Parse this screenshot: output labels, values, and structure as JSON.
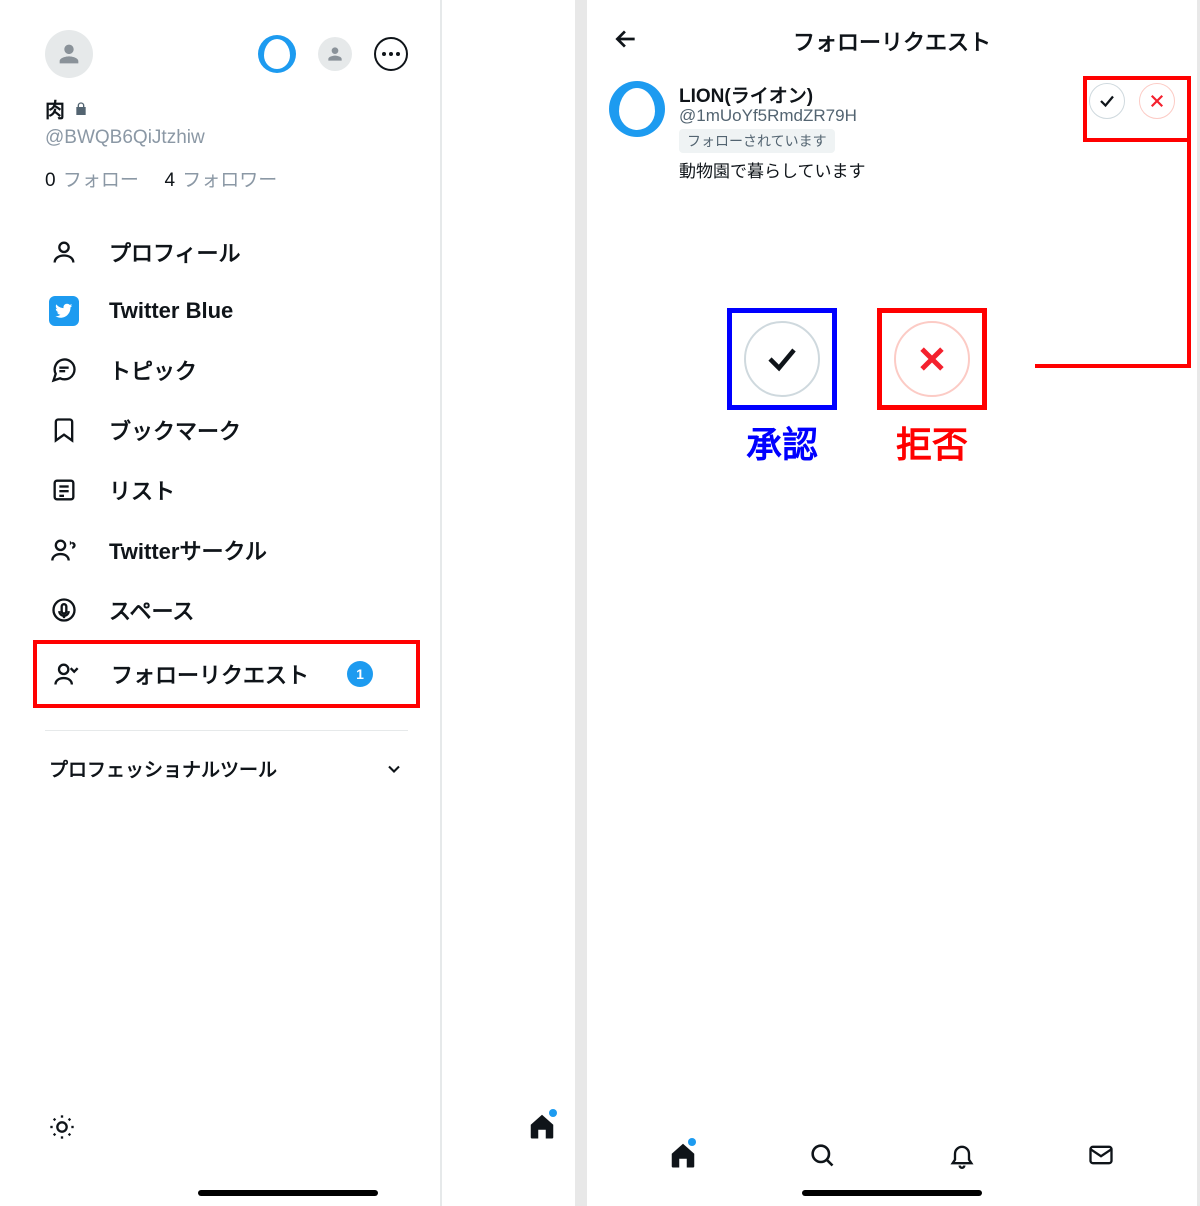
{
  "left": {
    "username": "肉",
    "handle": "@BWQB6QiJtzhiw",
    "following_count": "0",
    "following_label": "フォロー",
    "followers_count": "4",
    "followers_label": "フォロワー",
    "menu": {
      "profile": "プロフィール",
      "twitter_blue": "Twitter Blue",
      "topics": "トピック",
      "bookmarks": "ブックマーク",
      "lists": "リスト",
      "circle": "Twitterサークル",
      "spaces": "スペース",
      "follow_requests": "フォローリクエスト",
      "follow_requests_badge": "1"
    },
    "pro_tools": "プロフェッショナルツール"
  },
  "right": {
    "title": "フォローリクエスト",
    "request": {
      "name": "LION(ライオン)",
      "handle": "@1mUoYf5RmdZR79H",
      "followed_badge": "フォローされています",
      "bio": "動物園で暮らしています"
    },
    "annotations": {
      "approve": "承認",
      "reject": "拒否"
    }
  }
}
